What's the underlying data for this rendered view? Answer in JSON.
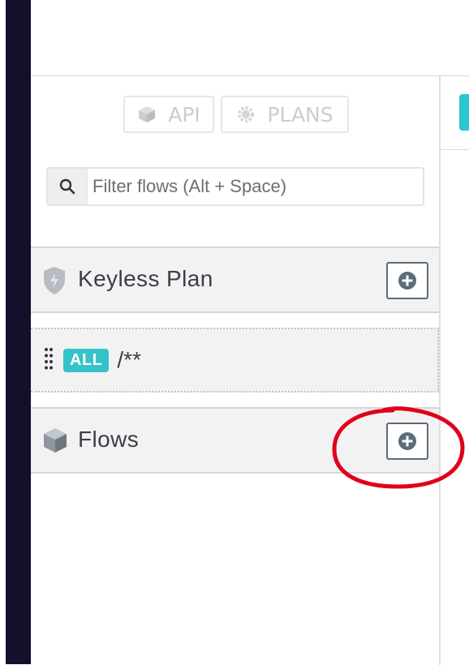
{
  "header": {
    "api_tab": "API",
    "plans_tab": "PLANS"
  },
  "search": {
    "placeholder": "Filter flows (Alt + Space)"
  },
  "plan_section": {
    "title": "Keyless Plan",
    "icon": "shield-lightning-icon",
    "add_icon": "plus-circle-icon"
  },
  "plan_flow": {
    "method": "ALL",
    "path": "/**",
    "handle_icon": "drag-handle-icon"
  },
  "flows_section": {
    "title": "Flows",
    "icon": "cube-icon",
    "add_icon": "plus-circle-icon"
  },
  "colors": {
    "rail": "#150f2c",
    "accent": "#34c3c8",
    "annotation": "#e0001a"
  }
}
